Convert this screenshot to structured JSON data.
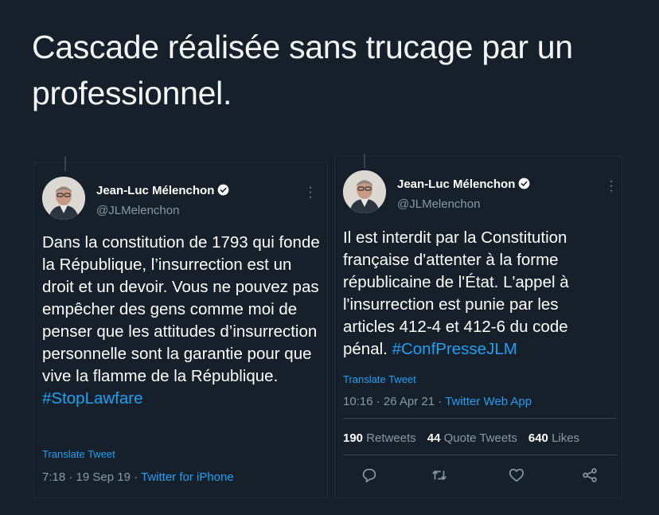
{
  "caption": "Cascade réalisée sans trucage par un professionnel.",
  "colors": {
    "background": "#15202b",
    "link": "#1da1f2",
    "muted": "#8899a6"
  },
  "tweet_left": {
    "author_name": "Jean-Luc Mélenchon",
    "handle": "@JLMelenchon",
    "text": "Dans la constitution de 1793 qui fonde la République, l’insurrection est un droit et un devoir. Vous ne pouvez pas empêcher des gens comme moi de penser que les attitudes d’insurrection personnelle sont la garantie pour que vive la flamme de la République.",
    "hashtag": "#StopLawfare",
    "translate": "Translate Tweet",
    "time": "7:18 · 19 Sep 19 · ",
    "source": "Twitter for iPhone",
    "icons": [
      "verified-badge-icon",
      "more-options-icon"
    ]
  },
  "tweet_right": {
    "author_name": "Jean-Luc Mélenchon",
    "handle": "@JLMelenchon",
    "text": "Il est interdit par la Constitution française d'attenter à la forme républicaine de l'État. L'appel à l'insurrection est punie par les articles 412-4 et 412-6 du code pénal.",
    "hashtag": "#ConfPresseJLM",
    "translate": "Translate Tweet",
    "time": "10:16 · 26 Apr 21 · ",
    "source": "Twitter Web App",
    "retweets_count": "190",
    "retweets_label": "Retweets",
    "quotes_count": "44",
    "quotes_label": "Quote Tweets",
    "likes_count": "640",
    "likes_label": "Likes",
    "icons": [
      "verified-badge-icon",
      "more-options-icon",
      "reply-icon",
      "retweet-icon",
      "like-icon",
      "share-icon"
    ]
  }
}
